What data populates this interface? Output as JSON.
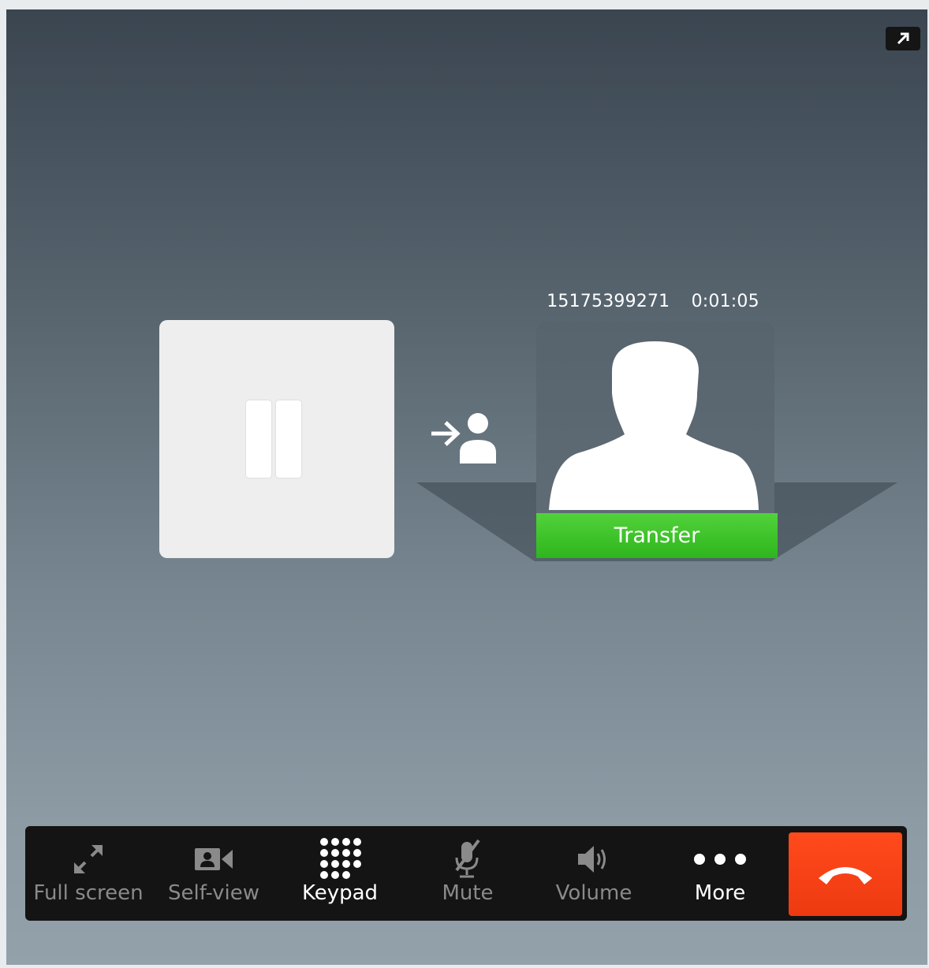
{
  "call": {
    "number": "15175399271",
    "duration": "0:01:05",
    "transfer_label": "Transfer"
  },
  "toolbar": {
    "full_screen": "Full screen",
    "self_view": "Self-view",
    "keypad": "Keypad",
    "mute": "Mute",
    "volume": "Volume",
    "more": "More"
  },
  "colors": {
    "transfer_green": "#33b820",
    "hangup_red": "#f2400f",
    "toolbar_bg": "#141414"
  },
  "icons": {
    "popout": "popout-arrow-icon",
    "hold": "pause-icon",
    "transfer": "transfer-to-person-icon",
    "avatar": "person-silhouette-icon",
    "full_screen": "expand-arrows-icon",
    "self_view": "video-camera-icon",
    "keypad": "keypad-dots-icon",
    "mute": "microphone-muted-icon",
    "volume": "speaker-icon",
    "more": "ellipsis-icon",
    "hangup": "phone-hangup-icon"
  }
}
